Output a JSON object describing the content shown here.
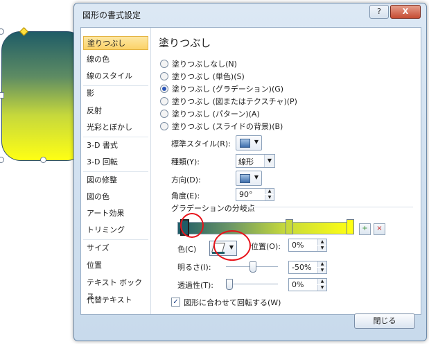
{
  "dialog": {
    "title": "図形の書式設定",
    "help_label": "?",
    "close_label": "X",
    "close_button_label": "閉じる"
  },
  "nav": {
    "items": [
      {
        "label": "塗りつぶし",
        "selected": true
      },
      {
        "label": "線の色"
      },
      {
        "label": "線のスタイル"
      },
      {
        "label": "影"
      },
      {
        "label": "反射"
      },
      {
        "label": "光彩とぼかし"
      },
      {
        "label": "3-D 書式"
      },
      {
        "label": "3-D 回転"
      },
      {
        "label": "図の修整"
      },
      {
        "label": "図の色"
      },
      {
        "label": "アート効果"
      },
      {
        "label": "トリミング"
      },
      {
        "label": "サイズ"
      },
      {
        "label": "位置"
      },
      {
        "label": "テキスト ボックス"
      },
      {
        "label": "代替テキスト"
      }
    ]
  },
  "fill": {
    "heading": "塗りつぶし",
    "options": [
      {
        "label": "塗りつぶしなし(N)",
        "checked": false
      },
      {
        "label": "塗りつぶし (単色)(S)",
        "checked": false
      },
      {
        "label": "塗りつぶし (グラデーション)(G)",
        "checked": true
      },
      {
        "label": "塗りつぶし (図またはテクスチャ)(P)",
        "checked": false
      },
      {
        "label": "塗りつぶし (パターン)(A)",
        "checked": false
      },
      {
        "label": "塗りつぶし (スライドの背景)(B)",
        "checked": false
      }
    ],
    "preset_label": "標準スタイル(R):",
    "type_label": "種類(Y):",
    "type_value": "線形",
    "direction_label": "方向(D):",
    "angle_label": "角度(E):",
    "angle_value": "90°",
    "stops_label": "グラデーションの分岐点",
    "color_label": "色(C)",
    "position_label": "位置(O):",
    "position_value": "0%",
    "brightness_label": "明るさ(I):",
    "brightness_value": "-50%",
    "transparency_label": "透過性(T):",
    "transparency_value": "0%",
    "rotate_label": "図形に合わせて回転する(W)",
    "rotate_checked": true
  },
  "gradient": {
    "stop_colors": [
      "#1f5c67",
      "#c7da3b",
      "#ffff14"
    ],
    "stop_positions": [
      0,
      0.63,
      1.0
    ],
    "brightness_level": 0.5,
    "transparency_level": 0
  },
  "colors": {
    "highlight_ellipse": "#e8141b",
    "selected_nav": "#fbd268"
  },
  "icons": {
    "add_stop": "add-gradient-stop-icon",
    "remove_stop": "remove-gradient-stop-icon",
    "fill_bucket": "paint-bucket-icon"
  }
}
